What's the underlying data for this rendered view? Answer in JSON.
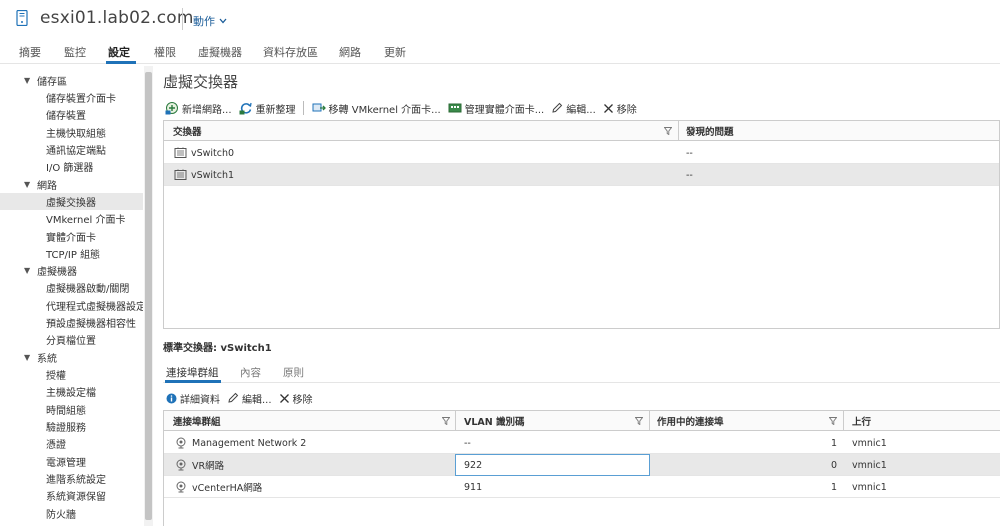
{
  "header": {
    "host_name": "esxi01.lab02.com",
    "actions_label": "動作"
  },
  "top_tabs": [
    {
      "label": "摘要"
    },
    {
      "label": "監控"
    },
    {
      "label": "設定",
      "active": true
    },
    {
      "label": "權限"
    },
    {
      "label": "虛擬機器"
    },
    {
      "label": "資料存放區"
    },
    {
      "label": "網路"
    },
    {
      "label": "更新"
    }
  ],
  "sidebar": {
    "items": [
      {
        "label": "儲存區",
        "type": "group"
      },
      {
        "label": "儲存裝置介面卡",
        "type": "child"
      },
      {
        "label": "儲存裝置",
        "type": "child"
      },
      {
        "label": "主機快取組態",
        "type": "child"
      },
      {
        "label": "通訊協定端點",
        "type": "child"
      },
      {
        "label": "I/O 篩選器",
        "type": "child"
      },
      {
        "label": "網路",
        "type": "group"
      },
      {
        "label": "虛擬交換器",
        "type": "child",
        "selected": true
      },
      {
        "label": "VMkernel 介面卡",
        "type": "child"
      },
      {
        "label": "實體介面卡",
        "type": "child"
      },
      {
        "label": "TCP/IP 組態",
        "type": "child"
      },
      {
        "label": "虛擬機器",
        "type": "group"
      },
      {
        "label": "虛擬機器啟動/關閉",
        "type": "child"
      },
      {
        "label": "代理程式虛擬機器設定",
        "type": "child"
      },
      {
        "label": "預設虛擬機器相容性",
        "type": "child"
      },
      {
        "label": "分頁檔位置",
        "type": "child"
      },
      {
        "label": "系統",
        "type": "group"
      },
      {
        "label": "授權",
        "type": "child"
      },
      {
        "label": "主機設定檔",
        "type": "child"
      },
      {
        "label": "時間組態",
        "type": "child"
      },
      {
        "label": "驗證服務",
        "type": "child"
      },
      {
        "label": "憑證",
        "type": "child"
      },
      {
        "label": "電源管理",
        "type": "child"
      },
      {
        "label": "進階系統設定",
        "type": "child"
      },
      {
        "label": "系統資源保留",
        "type": "child"
      },
      {
        "label": "防火牆",
        "type": "child"
      }
    ]
  },
  "main": {
    "title": "虛擬交換器",
    "toolbar": {
      "add_network": "新增網路...",
      "refresh": "重新整理",
      "migrate_vmkernel": "移轉 VMkernel 介面卡...",
      "manage_physical": "管理實體介面卡...",
      "edit": "編輯...",
      "remove": "移除"
    },
    "switch_grid": {
      "columns": [
        "交換器",
        "發現的問題"
      ],
      "rows": [
        {
          "name": "vSwitch0",
          "issues": "--"
        },
        {
          "name": "vSwitch1",
          "issues": "--",
          "selected": true
        }
      ]
    },
    "selected_switch_label": "標準交換器: vSwitch1",
    "lower_tabs": [
      {
        "label": "連接埠群組",
        "active": true
      },
      {
        "label": "內容"
      },
      {
        "label": "原則"
      }
    ],
    "pg_toolbar": {
      "details": "詳細資料",
      "edit": "編輯...",
      "remove": "移除"
    },
    "portgroup_grid": {
      "columns": [
        "連接埠群組",
        "VLAN 識別碼",
        "作用中的連接埠",
        "上行"
      ],
      "rows": [
        {
          "name": "Management Network 2",
          "vlan": "--",
          "active_ports": "1",
          "uplink": "vmnic1"
        },
        {
          "name": "VR網路",
          "vlan": "922",
          "active_ports": "0",
          "uplink": "vmnic1",
          "selected": true,
          "editing": true
        },
        {
          "name": "vCenterHA網路",
          "vlan": "911",
          "active_ports": "1",
          "uplink": "vmnic1"
        }
      ]
    }
  },
  "colors": {
    "accent": "#1f72b8",
    "link": "#1a5c99",
    "selected_row": "#e8e8e8",
    "border": "#cccccc"
  }
}
